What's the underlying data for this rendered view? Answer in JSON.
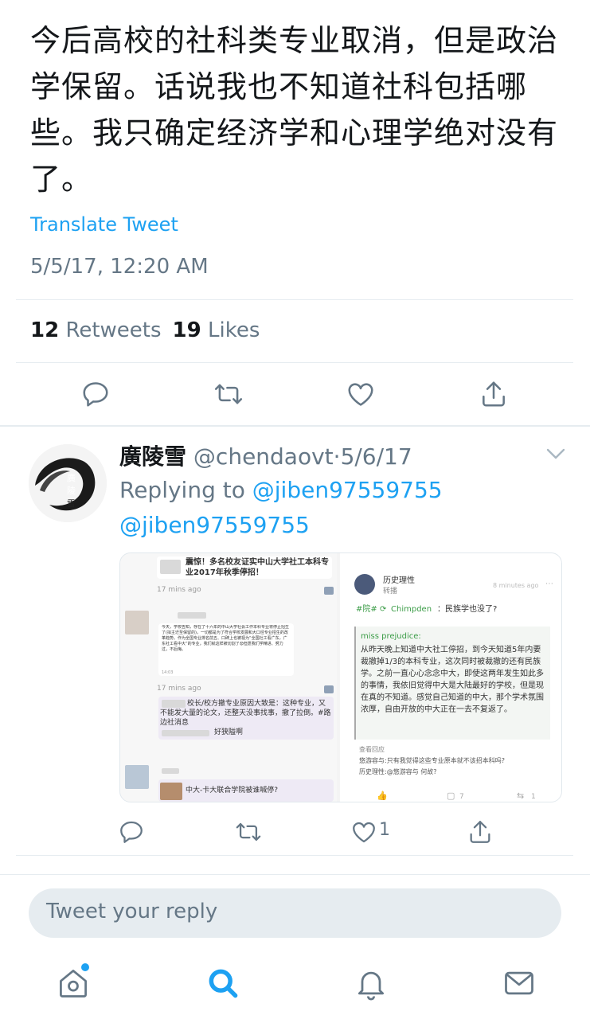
{
  "tweet": {
    "text": "今后高校的社科类专业取消，但是政治学保留。话说我也不知道社科包括哪些。我只确定经济学和心理学绝对没有了。",
    "translate_label": "Translate Tweet",
    "timestamp": "5/5/17, 12:20 AM",
    "retweets_count": "12",
    "retweets_label": "Retweets",
    "likes_count": "19",
    "likes_label": "Likes",
    "actions": {
      "reply_icon": "reply-icon",
      "retweet_icon": "retweet-icon",
      "like_icon": "heart-icon",
      "share_icon": "share-icon"
    }
  },
  "reply": {
    "display_name": "廣陵雪",
    "handle": "@chendaovt",
    "separator": "·",
    "date": "5/6/17",
    "replying_prefix": "Replying to",
    "replying_handle_1": "@jiben97559755",
    "replying_handle_2": "@jiben97559755",
    "avatar_text": "廣陵雪",
    "like_count": "1",
    "media": {
      "left": {
        "headline": "震惊！多名校友证实中山大学社工本科专业2017年秋季停招！",
        "time_1": "17 mins ago",
        "post_body": "今天，学校告知，存在了十六年的中山大学社会工作本科专业将停止招生了(拟主迁至保留的)，一切都是为了符合学校发展和大口径专业招生的改革趋势。作为全国专业排名前五、口碑上也被视为“全国社工看广东，广东社工看中大”的专业，我们就这样被切割了😟但愿我们学精进、努力过，不后悔。",
        "post_time": "14:03",
        "time_2": "17 mins ago",
        "comment_1": "校长/校方撤专业原因大致是：这种专业，又不能发大量的论文，还整天没事找事，撤了拉倒。#路边社消息",
        "comment_2": "好狭隘啊",
        "footer": "中大-卡大联合学院被谁喊停?"
      },
      "right": {
        "user": "历史理性",
        "subtitle": "转播",
        "time": "8 minutes ago",
        "tag": "#院#",
        "mention": "Chimpden",
        "question": "：民族学也没了?",
        "quote_user": "miss prejudice:",
        "quote_body": "从昨天晚上知道中大社工停招，到今天知道5年内要裁撤掉1/3的本科专业，这次同时被裁撤的还有民族学。之前一直心心念念中大，即使这两年发生如此多的事情，我依旧觉得中大是大陆最好的学校，但是现在真的不知道。感觉自己知道的中大，那个学术氛围浓厚，自由开放的中大正在一去不复返了。",
        "replies_label": "查看回应",
        "reply_1": "悠游容与:只有我觉得这些专业原本就不该招本科吗?",
        "reply_2": "历史理性:@悠游容与 何故?",
        "comment_count": "7",
        "repost_count": "1"
      }
    }
  },
  "compose": {
    "placeholder": "Tweet your reply"
  },
  "tab_bar": {
    "home_icon": "home-icon",
    "search_icon": "search-icon",
    "notifications_icon": "bell-icon",
    "messages_icon": "mail-icon"
  },
  "colors": {
    "accent": "#1da1f2",
    "secondary_text": "#657786",
    "divider": "#e6ecf0"
  }
}
